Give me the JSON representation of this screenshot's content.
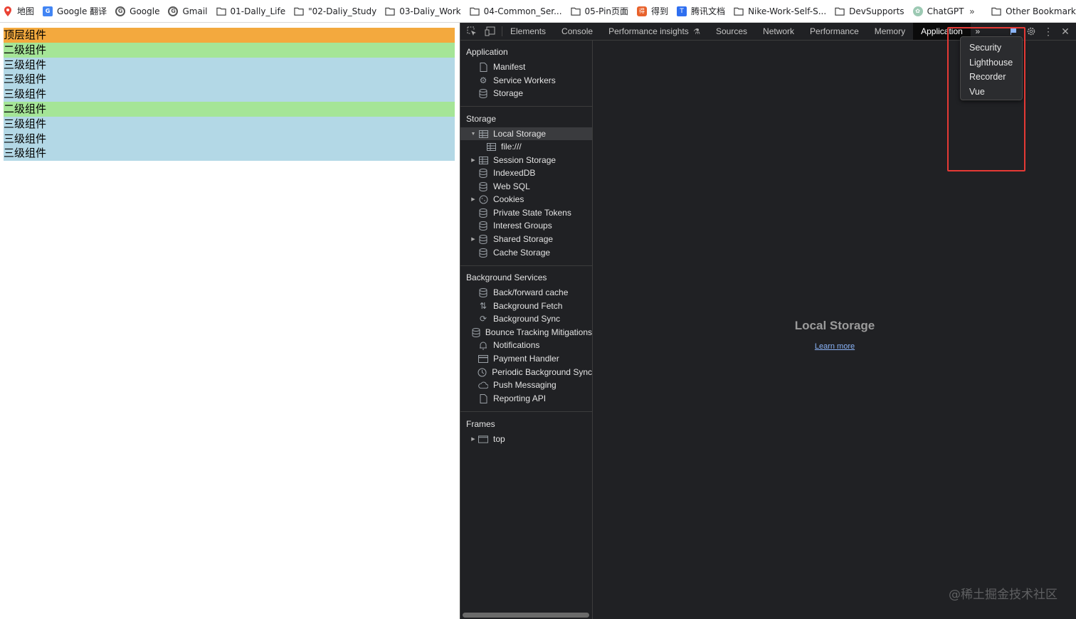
{
  "bookmarks": {
    "items": [
      {
        "label": "地图",
        "icon": "map-pin-icon"
      },
      {
        "label": "Google 翻译",
        "icon": "google-translate-icon"
      },
      {
        "label": "Google",
        "icon": "google-icon"
      },
      {
        "label": "Gmail",
        "icon": "google-icon"
      },
      {
        "label": "01-Dally_Life",
        "icon": "folder-icon"
      },
      {
        "label": "\"02-Daliy_Study",
        "icon": "folder-icon"
      },
      {
        "label": "03-Daliy_Work",
        "icon": "folder-icon"
      },
      {
        "label": "04-Common_Ser...",
        "icon": "folder-icon"
      },
      {
        "label": "05-Pin页面",
        "icon": "folder-icon"
      },
      {
        "label": "得到",
        "icon": "dedao-icon"
      },
      {
        "label": "腾讯文档",
        "icon": "tencent-docs-icon"
      },
      {
        "label": "Nike-Work-Self-S...",
        "icon": "folder-icon"
      },
      {
        "label": "DevSupports",
        "icon": "folder-icon"
      },
      {
        "label": "ChatGPT",
        "icon": "chatgpt-icon"
      }
    ],
    "overflow": "»",
    "other": "Other Bookmarks"
  },
  "page": {
    "components": [
      {
        "text": "顶层组件",
        "level": "top"
      },
      {
        "text": "二级组件",
        "level": "l2"
      },
      {
        "text": "三级组件",
        "level": "l3"
      },
      {
        "text": "三级组件",
        "level": "l3"
      },
      {
        "text": "三级组件",
        "level": "l3"
      },
      {
        "text": "二级组件",
        "level": "l2"
      },
      {
        "text": "三级组件",
        "level": "l3"
      },
      {
        "text": "三级组件",
        "level": "l3"
      },
      {
        "text": "三级组件",
        "level": "l3"
      }
    ]
  },
  "devtools": {
    "tabs": [
      "Elements",
      "Console",
      "Performance insights",
      "Sources",
      "Network",
      "Performance",
      "Memory",
      "Application"
    ],
    "active_tab": "Application",
    "overflow_menu": [
      "Security",
      "Lighthouse",
      "Recorder",
      "Vue"
    ],
    "sidebar": {
      "application": {
        "title": "Application",
        "items": [
          "Manifest",
          "Service Workers",
          "Storage"
        ]
      },
      "storage": {
        "title": "Storage",
        "items": [
          "Local Storage",
          "file:///",
          "Session Storage",
          "IndexedDB",
          "Web SQL",
          "Cookies",
          "Private State Tokens",
          "Interest Groups",
          "Shared Storage",
          "Cache Storage"
        ]
      },
      "background": {
        "title": "Background Services",
        "items": [
          "Back/forward cache",
          "Background Fetch",
          "Background Sync",
          "Bounce Tracking Mitigations",
          "Notifications",
          "Payment Handler",
          "Periodic Background Sync",
          "Push Messaging",
          "Reporting API"
        ]
      },
      "frames": {
        "title": "Frames",
        "items": [
          "top"
        ]
      }
    },
    "main": {
      "title": "Local Storage",
      "link": "Learn more"
    }
  },
  "watermark": "@稀土掘金技术社区",
  "colors": {
    "top": "#f3a93e",
    "level2": "#a5e597",
    "level3": "#b3d8e6",
    "highlight": "#e53935",
    "devtools_bg": "#202124"
  }
}
